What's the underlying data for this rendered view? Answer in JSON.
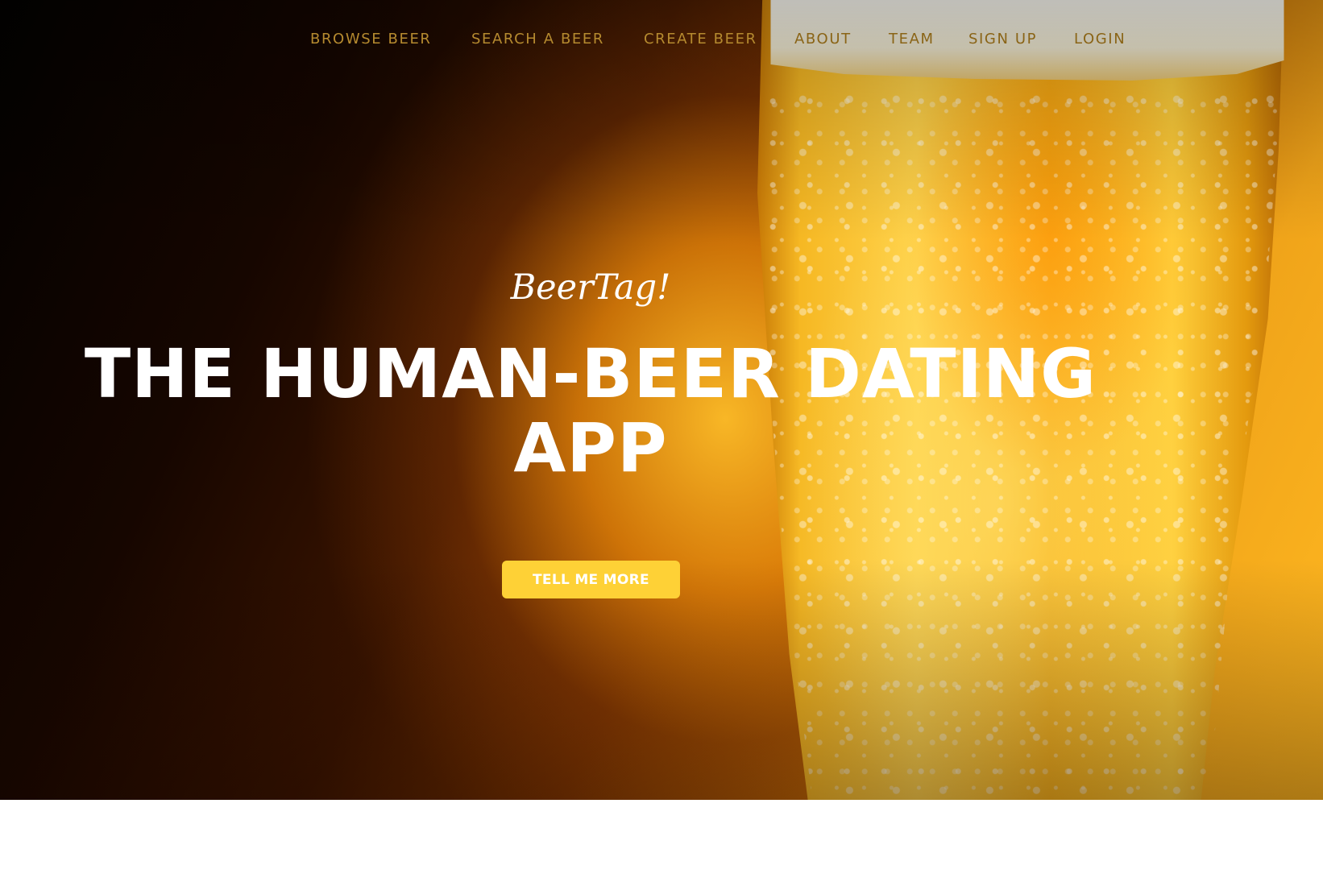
{
  "nav": {
    "items": [
      {
        "label": "BROWSE BEER"
      },
      {
        "label": "SEARCH A BEER"
      },
      {
        "label": "CREATE BEER"
      },
      {
        "label": "ABOUT"
      },
      {
        "label": "TEAM"
      },
      {
        "label": "SIGN UP"
      },
      {
        "label": "LOGIN"
      }
    ]
  },
  "hero": {
    "brand": "BeerTag!",
    "headline": "THE HUMAN-BEER DATING APP",
    "cta_label": "TELL ME MORE",
    "background_image": "beer-glass-photo"
  },
  "colors": {
    "accent": "#fed136",
    "nav_text": "#b58a2f",
    "headline_text": "#ffffff"
  }
}
